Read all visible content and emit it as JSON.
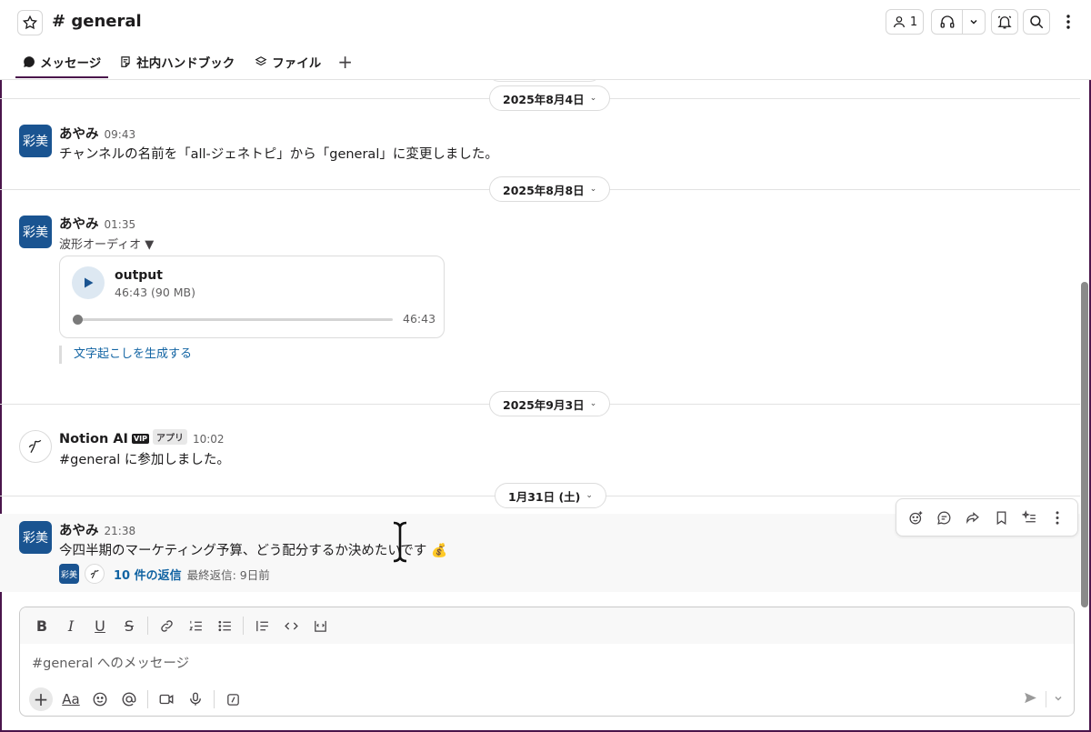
{
  "header": {
    "channel": "# general",
    "members_count": "1",
    "tabs": [
      {
        "label": "メッセージ",
        "icon": "message-bubble-icon"
      },
      {
        "label": "社内ハンドブック",
        "icon": "canvas-doc-icon"
      },
      {
        "label": "ファイル",
        "icon": "layers-icon"
      }
    ],
    "add_tab": "+"
  },
  "messages": {
    "dates": [
      "2025年8月4日",
      "2025年8月8日",
      "2025年9月3日",
      "1月31日 (土)"
    ],
    "m1": {
      "avatar": "彩美",
      "sender": "あやみ",
      "time": "09:43",
      "text": "チャンネルの名前を「all-ジェネトピ」から「general」に変更しました。"
    },
    "m2": {
      "avatar": "彩美",
      "sender": "あやみ",
      "time": "01:35",
      "subtitle": "波形オーディオ ▼",
      "audio": {
        "title": "output",
        "meta": "46:43 (90 MB)",
        "duration": "46:43",
        "progress": 0
      },
      "transcript_link": "文字起こしを生成する"
    },
    "m3": {
      "sender": "Notion AI",
      "vip": "VIP",
      "badge": "アプリ",
      "time": "10:02",
      "text": "#general に参加しました。"
    },
    "m4": {
      "avatar": "彩美",
      "sender": "あやみ",
      "time": "21:38",
      "text": "今四半期のマーケティング予算、どう配分するか決めたいです 💰",
      "thread": {
        "mini_avatar": "彩美",
        "replies": "10 件の返信",
        "last_reply": "最終返信: 9日前"
      }
    }
  },
  "composer": {
    "placeholder": "#general へのメッセージ",
    "font_button": "Aa"
  },
  "colors": {
    "accent": "#4a154b",
    "link": "#1264a3",
    "avatar_bg": "#1a5491"
  }
}
